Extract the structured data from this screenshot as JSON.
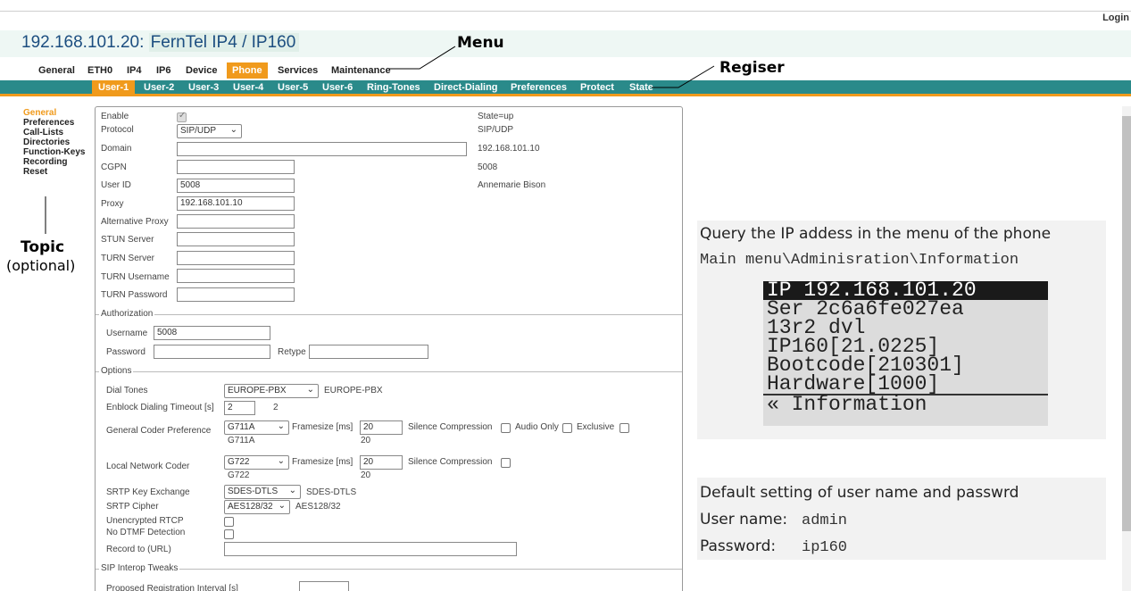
{
  "header": {
    "login": "Login",
    "title_ip": "192.168.101.20:",
    "title_model": "FernTel IP4 / IP160"
  },
  "main_nav": [
    "General",
    "ETH0",
    "IP4",
    "IP6",
    "Device",
    "Phone",
    "Services",
    "Maintenance"
  ],
  "main_nav_active": "Phone",
  "sub_nav": [
    "User-1",
    "User-2",
    "User-3",
    "User-4",
    "User-5",
    "User-6",
    "Ring-Tones",
    "Direct-Dialing",
    "Preferences",
    "Protect",
    "State"
  ],
  "sub_nav_active": "User-1",
  "annotations": {
    "menu": "Menu",
    "register": "Regiser",
    "topic": "Topic",
    "topic_sub": "(optional)"
  },
  "left_nav": [
    "General",
    "Preferences",
    "Call-Lists",
    "Directories",
    "Function-Keys",
    "Recording",
    "Reset"
  ],
  "left_nav_active": "General",
  "form": {
    "enable": "Enable",
    "protocol": "Protocol",
    "protocol_value": "SIP/UDP",
    "domain": "Domain",
    "domain_value": "",
    "cgpn": "CGPN",
    "cgpn_value": "",
    "user_id": "User ID",
    "user_id_value": "5008",
    "proxy": "Proxy",
    "proxy_value": "192.168.101.10",
    "alt_proxy": "Alternative Proxy",
    "stun": "STUN Server",
    "turn": "TURN Server",
    "turn_user": "TURN Username",
    "turn_pass": "TURN Password",
    "state_title": "State=up",
    "state_protocol": "SIP/UDP",
    "state_ip": "192.168.101.10",
    "state_number": "5008",
    "state_name": "Annemarie Bison",
    "authorization": "Authorization",
    "username": "Username",
    "username_value": "5008",
    "password": "Password",
    "retype": "Retype",
    "options": "Options",
    "dial_tones": "Dial Tones",
    "dial_tones_value": "EUROPE-PBX",
    "dial_tones_state": "EUROPE-PBX",
    "enblock": "Enblock Dialing Timeout [s]",
    "enblock_value": "2",
    "enblock_state": "2",
    "gen_coder": "General Coder Preference",
    "gen_coder_value": "G711A",
    "gen_coder_state": "G711A",
    "framesize": "Framesize [ms]",
    "gen_frame_value": "20",
    "gen_frame_state": "20",
    "silence": "Silence Compression",
    "audio_only": "Audio Only",
    "exclusive": "Exclusive",
    "local_coder": "Local Network Coder",
    "local_coder_value": "G722",
    "local_coder_state": "G722",
    "local_frame_value": "20",
    "local_frame_state": "20",
    "srtp_key": "SRTP Key Exchange",
    "srtp_key_value": "SDES-DTLS",
    "srtp_key_state": "SDES-DTLS",
    "srtp_cipher": "SRTP Cipher",
    "srtp_cipher_value": "AES128/32",
    "srtp_cipher_state": "AES128/32",
    "unencrypted_rtcp": "Unencrypted RTCP",
    "no_dtmf": "No DTMF Detection",
    "record_url": "Record to (URL)",
    "sip_interop": "SIP Interop Tweaks",
    "proposed_reg": "Proposed Registration Interval [s]"
  },
  "info_panel": {
    "query_text": "Query the IP addess in the menu of the phone",
    "path_text": "Main menu\\Adminisration\\Information",
    "lcd_rows": [
      "IP  192.168.101.20",
      "Ser 2c6a6fe027ea",
      "13r2 dvl",
      "IP160[21.0225]",
      "Bootcode[210301]",
      "Hardware[1000]"
    ],
    "lcd_back": "« Information"
  },
  "defaults_panel": {
    "title": "Default setting of user name and passwrd",
    "user_label": "User name:",
    "user_value": "admin",
    "pass_label": "Password:",
    "pass_value": "ip160"
  }
}
